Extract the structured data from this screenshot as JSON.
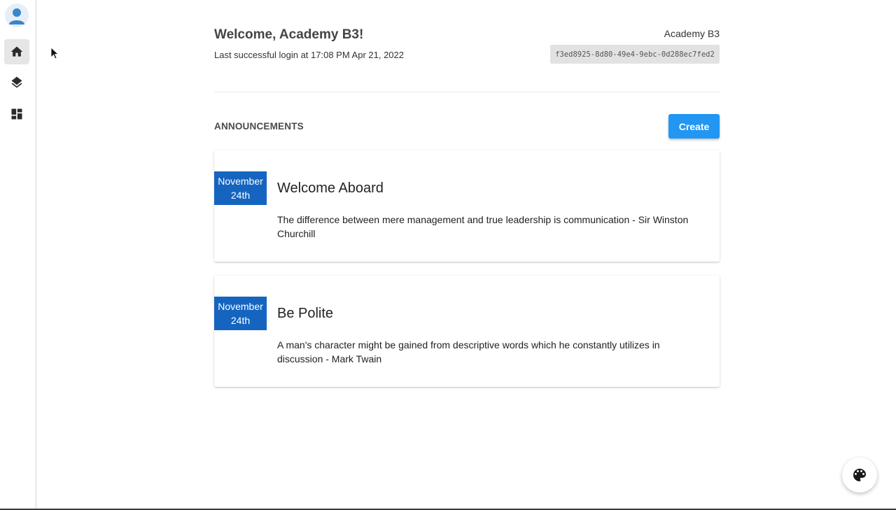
{
  "sidebar": {
    "items": [
      {
        "name": "home",
        "icon": "home-icon",
        "active": true
      },
      {
        "name": "layers",
        "icon": "layers-icon",
        "active": false
      },
      {
        "name": "dashboard",
        "icon": "dashboard-icon",
        "active": false
      }
    ]
  },
  "header": {
    "welcome": "Welcome, Academy B3!",
    "last_login": "Last successful login at 17:08 PM Apr 21, 2022",
    "org_name": "Academy B3",
    "org_id": "f3ed8925-8d80-49e4-9ebc-0d288ec7fed2"
  },
  "announcements": {
    "title": "ANNOUNCEMENTS",
    "create_label": "Create",
    "items": [
      {
        "month": "November",
        "day": "24th",
        "title": "Welcome Aboard",
        "body": "The difference between mere management and true leadership is communication - Sir Winston Churchill"
      },
      {
        "month": "November",
        "day": "24th",
        "title": "Be Polite",
        "body": "A man's character might be gained from descriptive words which he constantly utilizes in discussion - Mark Twain"
      }
    ]
  },
  "colors": {
    "accent": "#2196f3",
    "date_badge": "#1565c0"
  },
  "fab": {
    "icon": "palette-icon"
  }
}
